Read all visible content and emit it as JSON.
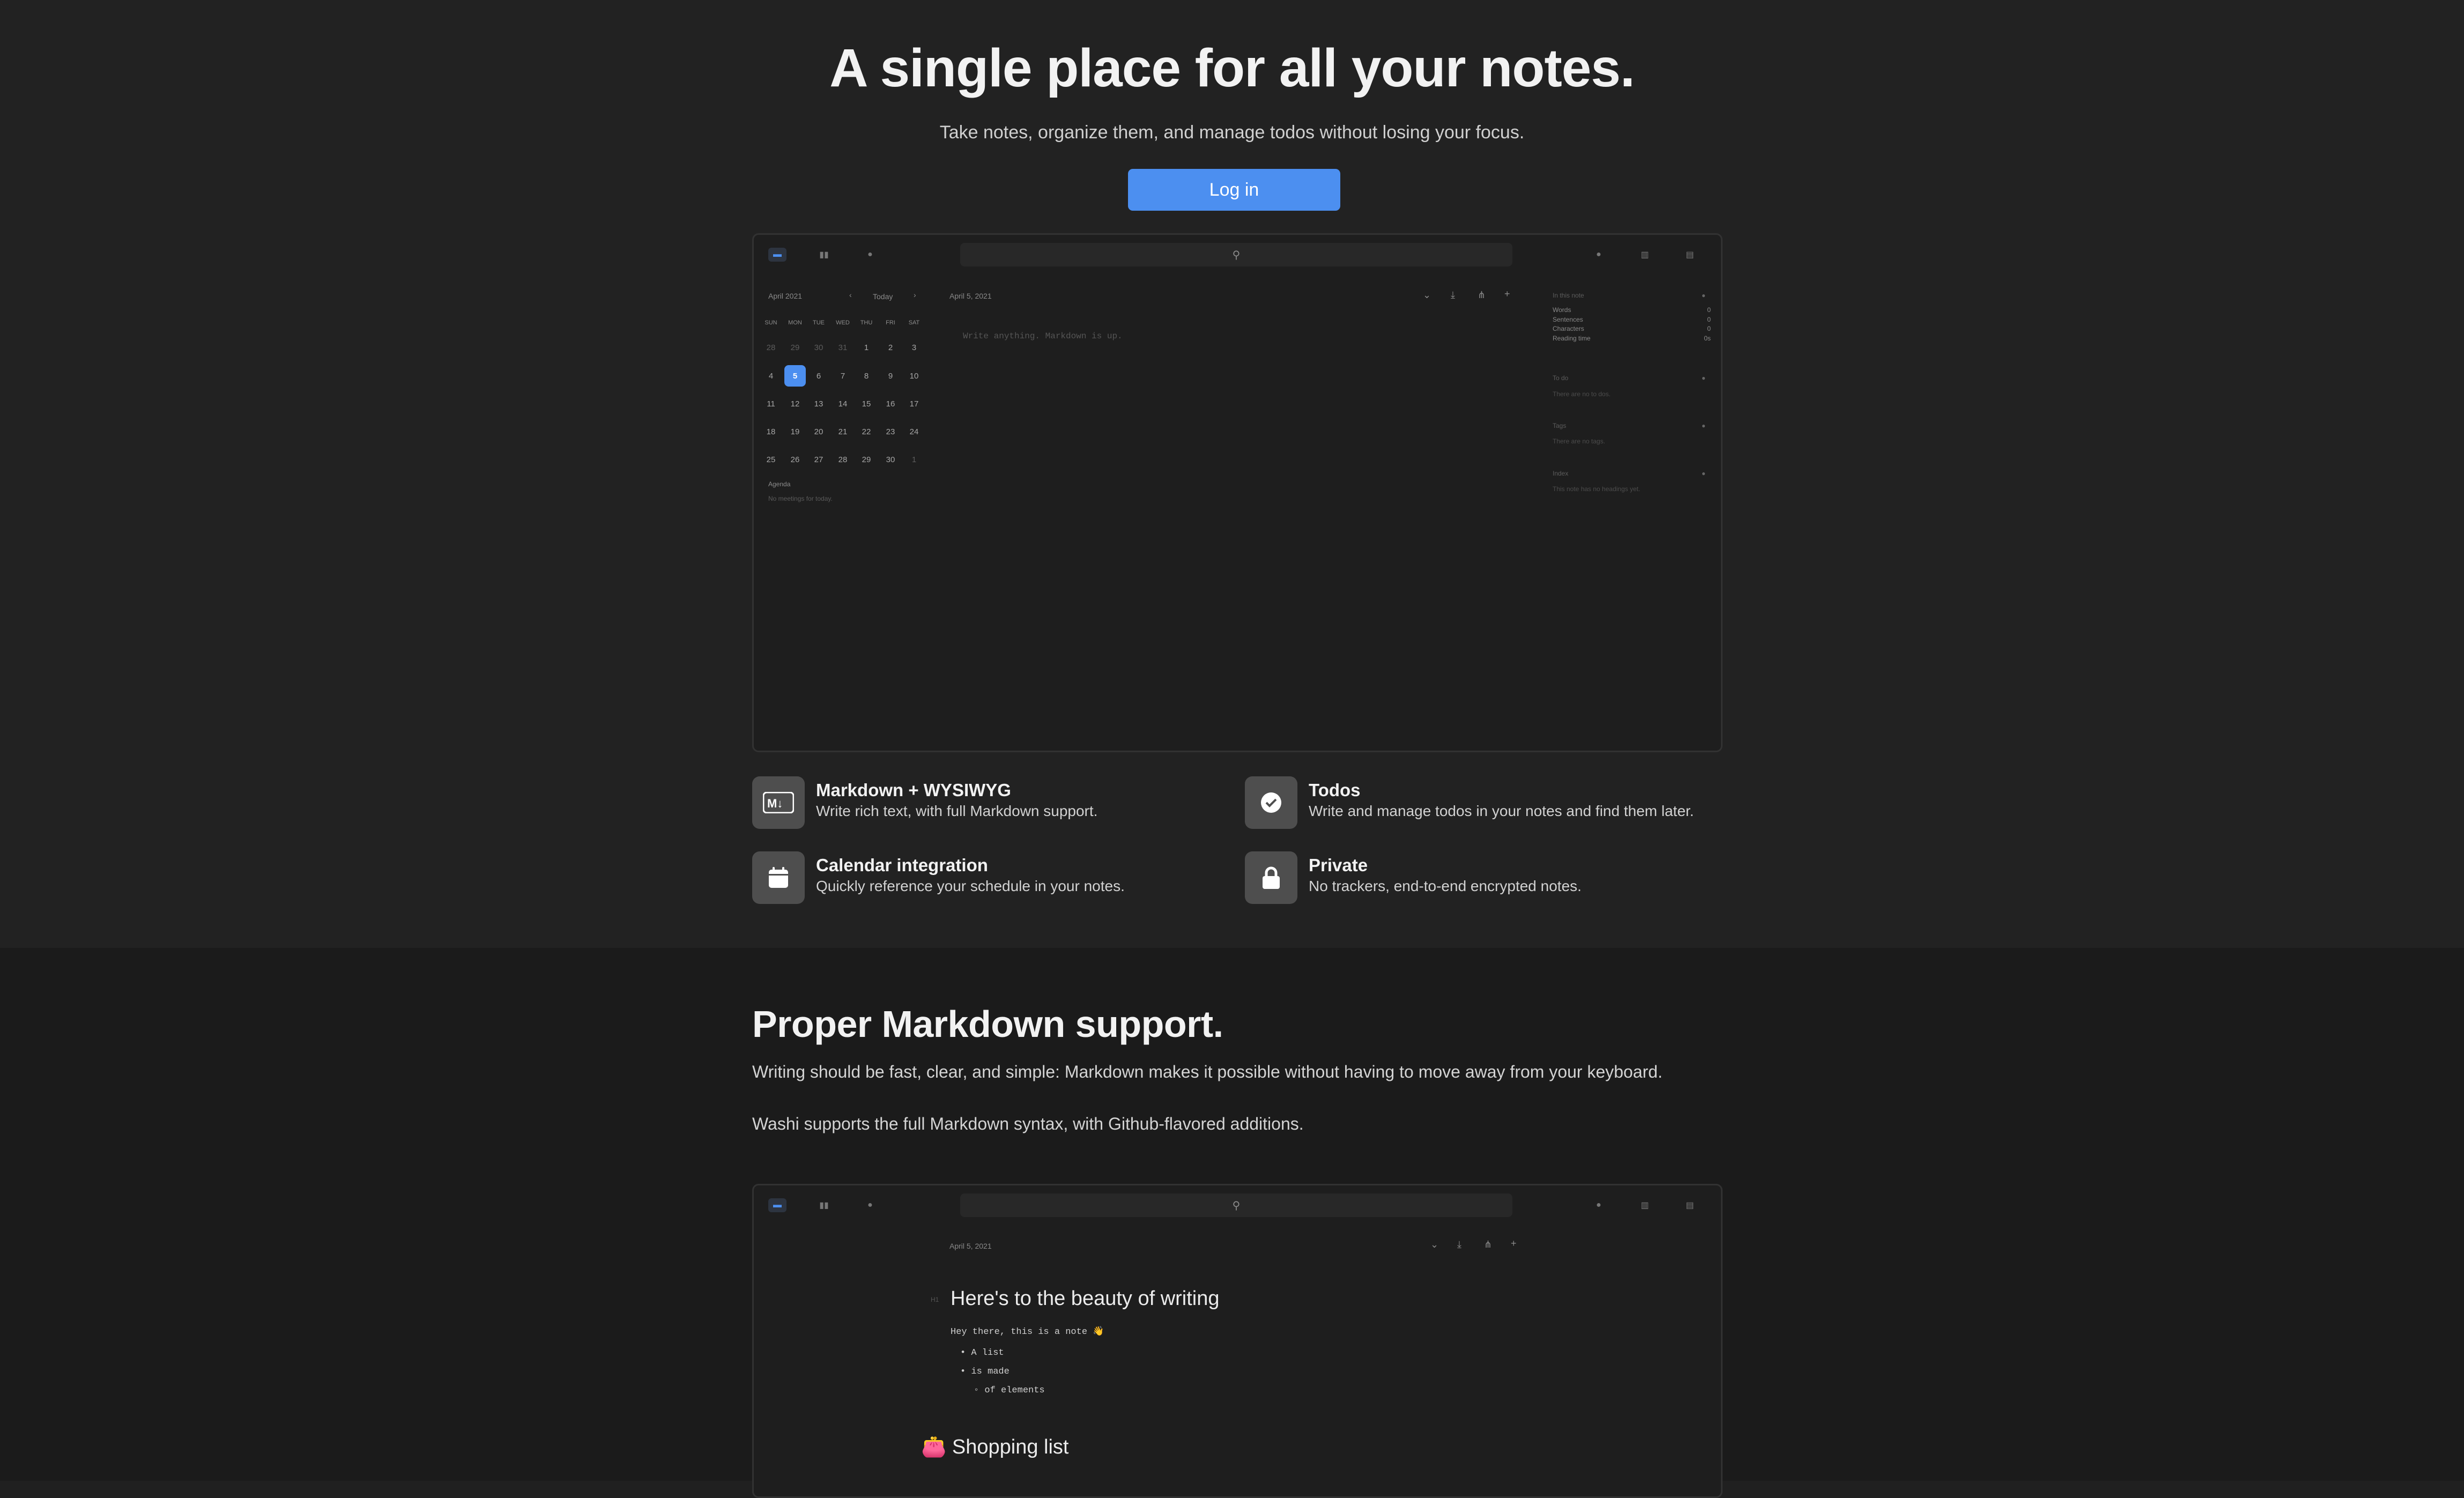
{
  "hero": {
    "title": "A single place for all your notes.",
    "subtitle": "Take notes, organize them, and manage todos without losing your focus.",
    "login_label": "Log in"
  },
  "app1": {
    "month_label": "April 2021",
    "today_label": "Today",
    "weekdays": [
      "SUN",
      "MON",
      "TUE",
      "WED",
      "THU",
      "FRI",
      "SAT"
    ],
    "weeks": [
      [
        "28",
        "29",
        "30",
        "31",
        "1",
        "2",
        "3"
      ],
      [
        "4",
        "5",
        "6",
        "7",
        "8",
        "9",
        "10"
      ],
      [
        "11",
        "12",
        "13",
        "14",
        "15",
        "16",
        "17"
      ],
      [
        "18",
        "19",
        "20",
        "21",
        "22",
        "23",
        "24"
      ],
      [
        "25",
        "26",
        "27",
        "28",
        "29",
        "30",
        "1"
      ]
    ],
    "selected_day": "5",
    "agenda_title": "Agenda",
    "agenda_empty": "No meetings for today.",
    "note_date": "April 5, 2021",
    "editor_placeholder": "Write anything. Markdown is up.",
    "sidebar": {
      "stats_title": "In this note",
      "stats": [
        {
          "label": "Words",
          "value": "0"
        },
        {
          "label": "Sentences",
          "value": "0"
        },
        {
          "label": "Characters",
          "value": "0"
        },
        {
          "label": "Reading time",
          "value": "0s"
        }
      ],
      "todo_title": "To do",
      "todo_empty": "There are no to dos.",
      "tags_title": "Tags",
      "tags_empty": "There are no tags.",
      "index_title": "Index",
      "index_empty": "This note has no headings yet."
    }
  },
  "features": [
    {
      "title": "Markdown + WYSIWYG",
      "desc": "Write rich text, with full Markdown support.",
      "icon": "markdown-icon"
    },
    {
      "title": "Todos",
      "desc": "Write and manage todos in your notes and find them later.",
      "icon": "check-circle-icon"
    },
    {
      "title": "Calendar integration",
      "desc": "Quickly reference your schedule in your notes.",
      "icon": "calendar-icon"
    },
    {
      "title": "Private",
      "desc": "No trackers, end-to-end encrypted notes.",
      "icon": "lock-icon"
    }
  ],
  "markdown_section": {
    "title": "Proper Markdown support.",
    "p1": "Writing should be fast, clear, and simple: Markdown makes it possible without having to move away from your keyboard.",
    "p2": "Washi supports the full Markdown syntax, with Github-flavored additions."
  },
  "app2": {
    "note_date": "April 5, 2021",
    "h1_marker": "H1",
    "heading": "Here's to the beauty of writing",
    "line1": "Hey there, this is a note 👋",
    "list": [
      "A list",
      "is made",
      "of elements"
    ],
    "shopping_heading": "👛 Shopping list"
  },
  "colors": {
    "accent": "#4c8ff0",
    "background": "#222222",
    "section_bg": "#1b1b1b"
  }
}
